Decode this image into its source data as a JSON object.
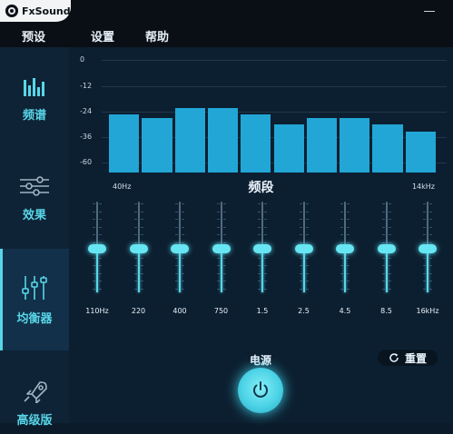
{
  "app": {
    "name": "FxSound"
  },
  "menu": {
    "items": [
      "预设",
      "设置",
      "帮助"
    ]
  },
  "sidebar": {
    "items": [
      {
        "id": "spectrum",
        "label": "频谱",
        "icon": "spectrum-bars-icon"
      },
      {
        "id": "effects",
        "label": "效果",
        "icon": "sliders-horizontal-icon"
      },
      {
        "id": "equalizer",
        "label": "均衡器",
        "icon": "equalizer-sliders-icon"
      },
      {
        "id": "advanced",
        "label": "高级版",
        "icon": "rocket-icon"
      }
    ],
    "active": "equalizer"
  },
  "chart_data": {
    "type": "bar",
    "xlabel": "频段",
    "x_range_labels": [
      "40Hz",
      "14kHz"
    ],
    "y_ticks": [
      "0",
      "-12",
      "-24",
      "-36",
      "-60"
    ],
    "ylim": [
      -60,
      0
    ],
    "values": [
      -36,
      -37.5,
      -33.5,
      -33.5,
      -36,
      -40,
      -37.5,
      -37.5,
      -40,
      -43
    ],
    "colors": {
      "bar": "#22a6d6"
    }
  },
  "equalizer": {
    "bands": [
      {
        "freq": "110Hz",
        "level": 0.48
      },
      {
        "freq": "220",
        "level": 0.48
      },
      {
        "freq": "400",
        "level": 0.48
      },
      {
        "freq": "750",
        "level": 0.48
      },
      {
        "freq": "1.5",
        "level": 0.48
      },
      {
        "freq": "2.5",
        "level": 0.48
      },
      {
        "freq": "4.5",
        "level": 0.48
      },
      {
        "freq": "8.5",
        "level": 0.48
      },
      {
        "freq": "16kHz",
        "level": 0.48
      }
    ]
  },
  "controls": {
    "power_label": "电源",
    "reset_label": "重置"
  },
  "colors": {
    "accent": "#58d6e8",
    "background": "#0c1f30",
    "sidebar": "#0f2336"
  }
}
